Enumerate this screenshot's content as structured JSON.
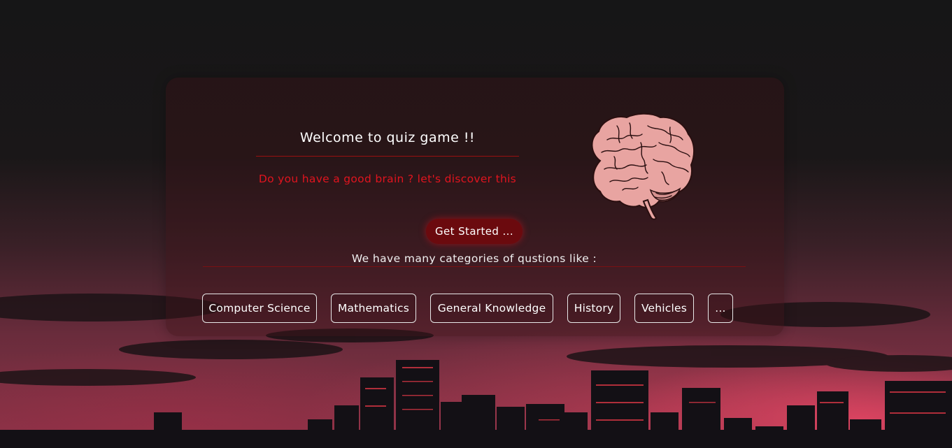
{
  "hero": {
    "title": "Welcome to quiz game !!",
    "tagline": "Do you have a good brain ? let's discover this",
    "start_label": "Get Started ..."
  },
  "categories": {
    "intro": "We have many categories of qustions like :",
    "items": [
      {
        "label": "Computer Science"
      },
      {
        "label": "Mathematics"
      },
      {
        "label": "General Knowledge"
      },
      {
        "label": "History"
      },
      {
        "label": "Vehicles"
      },
      {
        "label": "..."
      }
    ]
  },
  "colors": {
    "accent_red": "#e0141e",
    "button_bg": "#6b0a0e",
    "divider": "#9a1010",
    "brain_pink": "#e8a4a1"
  },
  "icons": {
    "brain": "brain-illustration"
  }
}
